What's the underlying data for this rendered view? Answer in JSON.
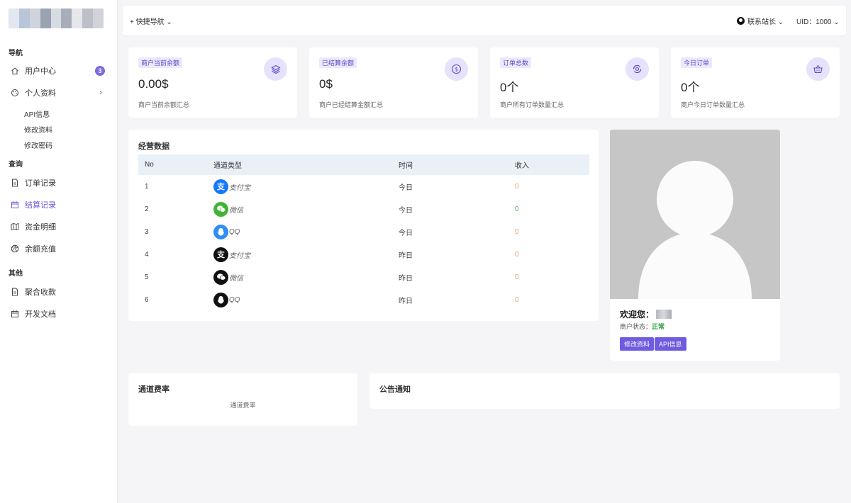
{
  "sidebar": {
    "sections": {
      "nav": "导航",
      "query": "查询",
      "other": "其他"
    },
    "items": {
      "user_center": {
        "label": "用户中心",
        "badge": "3"
      },
      "profile": {
        "label": "个人资料"
      },
      "api_info": "API信息",
      "edit_info": "修改资料",
      "edit_password": "修改密码",
      "order_records": {
        "label": "订单记录"
      },
      "settlement_records": {
        "label": "结算记录"
      },
      "fund_details": {
        "label": "资金明细"
      },
      "balance_recharge": {
        "label": "余额充值"
      },
      "aggregate_pay": {
        "label": "聚合收款"
      },
      "dev_docs": {
        "label": "开发文档"
      }
    }
  },
  "topbar": {
    "quick_nav": "+ 快捷导航 ⌄",
    "contact": "联系站长 ⌄",
    "uid": "UID：1000 ⌄"
  },
  "stats": [
    {
      "tag": "商户当前余额",
      "value": "0.00$",
      "desc": "商户当前余额汇总",
      "icon": "layers-icon"
    },
    {
      "tag": "已结算余额",
      "value": "0$",
      "desc": "商户已经结算金额汇总",
      "icon": "dollar-coin-icon"
    },
    {
      "tag": "订单总数",
      "value": "0个",
      "desc": "商户所有订单数量汇总",
      "icon": "refresh-ring-icon"
    },
    {
      "tag": "今日订单",
      "value": "0个",
      "desc": "商户今日订单数量汇总",
      "icon": "basket-icon"
    }
  ],
  "business": {
    "title": "经营数据",
    "headers": [
      "No",
      "通道类型",
      "时间",
      "收入"
    ],
    "rows": [
      {
        "no": "1",
        "channel": "支付宝",
        "time": "今日",
        "income": "0"
      },
      {
        "no": "2",
        "channel": "微信",
        "time": "今日",
        "income": "0"
      },
      {
        "no": "3",
        "channel": "QQ",
        "time": "今日",
        "income": "0"
      },
      {
        "no": "4",
        "channel": "支付宝",
        "time": "昨日",
        "income": "0"
      },
      {
        "no": "5",
        "channel": "微信",
        "time": "昨日",
        "income": "0"
      },
      {
        "no": "6",
        "channel": "QQ",
        "time": "昨日",
        "income": "0"
      }
    ],
    "colors": {
      "alipay": "#1677ff",
      "wechat": "#3fb536",
      "qq": "#2f8ef5",
      "dark": "#111111"
    }
  },
  "profile": {
    "welcome": "欢迎您：",
    "status_label": "商户状态：",
    "status_value": "正常",
    "edit_button": "修改资料",
    "api_button": "API信息"
  },
  "rate": {
    "title": "通道费率",
    "sub": "通道费率"
  },
  "notice": {
    "title": "公告通知"
  },
  "colors": {
    "accent": "#6e5be0",
    "accent_light": "#e6e2fb",
    "income_orange": "#f29a64",
    "income_green": "#4caf50"
  }
}
